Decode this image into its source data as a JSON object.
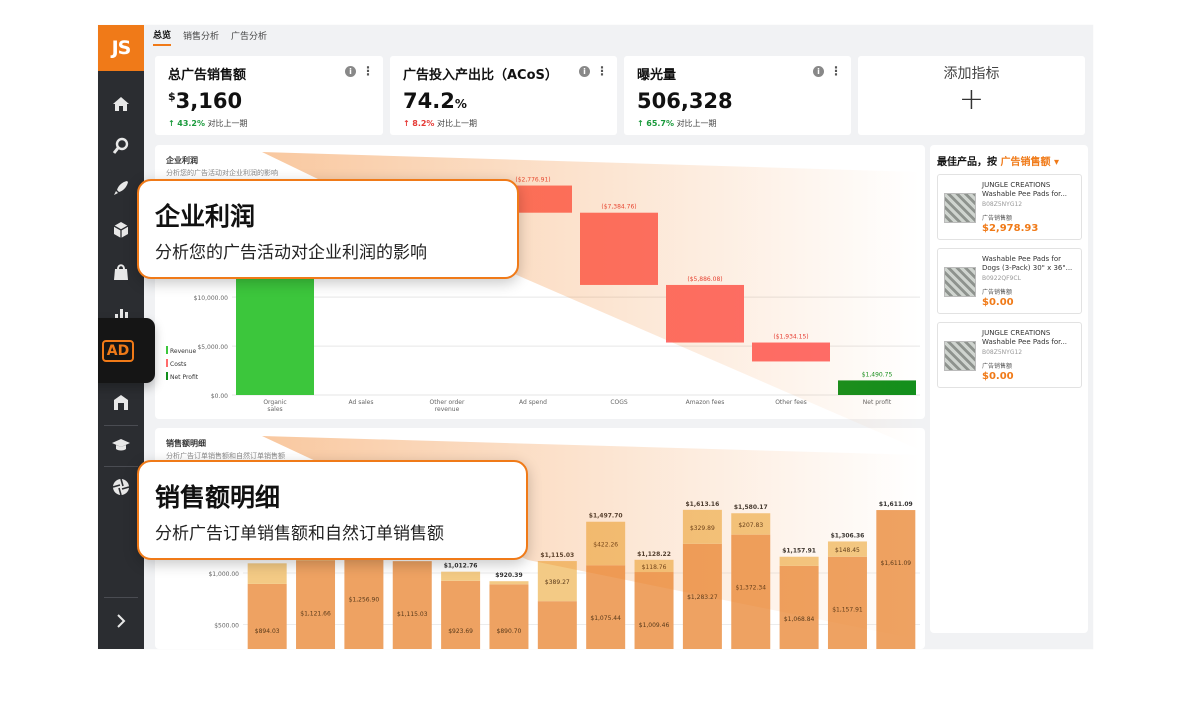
{
  "logo": "JS",
  "ad_badge": "AD",
  "tabs": [
    "总览",
    "销售分析",
    "广告分析"
  ],
  "kpis": [
    {
      "title": "总广告销售额",
      "currency": "$",
      "value": "3,160",
      "unit": "",
      "delta": "43.2%",
      "delta_color": "green",
      "compare": "对比上一期"
    },
    {
      "title": "广告投入产出比（ACoS）",
      "currency": "",
      "value": "74.2",
      "unit": "%",
      "delta": "8.2%",
      "delta_color": "red",
      "compare": "对比上一期"
    },
    {
      "title": "曝光量",
      "currency": "",
      "value": "506,328",
      "unit": "",
      "delta": "65.7%",
      "delta_color": "green",
      "compare": "对比上一期"
    }
  ],
  "add_kpi_label": "添加指标",
  "profit_panel": {
    "title": "企业利润",
    "subtitle": "分析您的广告活动对企业利润的影响",
    "legend": [
      "Revenue",
      "Costs",
      "Net Profit"
    ],
    "callout_title": "企业利润",
    "callout_sub": "分析您的广告活动对企业利润的影响"
  },
  "sales_panel": {
    "title": "销售额明细",
    "subtitle": "分析广告订单销售额和自然订单销售额",
    "callout_title": "销售额明细",
    "callout_sub": "分析广告订单销售额和自然订单销售额"
  },
  "right_panel": {
    "title": "最佳产品，按",
    "sort_by": "广告销售额",
    "products": [
      {
        "name": "JUNGLE CREATIONS Washable Pee Pads for...",
        "asin": "B08Z5NYG12",
        "label": "广告销售额",
        "value": "$2,978.93"
      },
      {
        "name": "Washable Pee Pads for Dogs (3-Pack) 30\" x 36\"...",
        "asin": "B0922QF9CL",
        "label": "广告销售额",
        "value": "$0.00"
      },
      {
        "name": "JUNGLE CREATIONS Washable Pee Pads for...",
        "asin": "B08Z5NYG12",
        "label": "广告销售额",
        "value": "$0.00"
      }
    ]
  },
  "colors": {
    "accent": "#f07a18",
    "revenue": "#3cc63c",
    "cost": "#ff6b6b",
    "net": "#128f1c",
    "organic_bar": "#eea262",
    "ad_bar": "#f3ca85"
  },
  "chart_data": [
    {
      "type": "bar",
      "subtype": "waterfall",
      "title": "企业利润",
      "categories": [
        "Organic sales",
        "Ad sales",
        "Other order revenue",
        "Ad spend",
        "COGS",
        "Amazon fees",
        "Other fees",
        "Net profit"
      ],
      "category_labels": [
        [
          "Organic",
          "sales"
        ],
        [
          "Ad sales"
        ],
        [
          "Other order",
          "revenue"
        ],
        [
          "Ad spend"
        ],
        [
          "COGS"
        ],
        [
          "Amazon fees"
        ],
        [
          "Other fees"
        ],
        [
          "Net profit"
        ]
      ],
      "values": [
        21411.12,
        0,
        0,
        -2776.91,
        -7384.76,
        -5886.08,
        -1934.15,
        1490.75
      ],
      "value_labels": [
        "",
        "",
        "",
        "($2,776.91)",
        "($7,384.76)",
        "($5,886.08)",
        "($1,934.15)",
        "$1,490.75"
      ],
      "kinds": [
        "revenue",
        "revenue",
        "revenue",
        "cost",
        "cost",
        "cost",
        "cost",
        "net"
      ],
      "y_ticks": [
        "$0.00",
        "$5,000.00",
        "$10,000.00"
      ],
      "ylim": [
        0,
        23000
      ]
    },
    {
      "type": "bar",
      "subtype": "stacked",
      "title": "销售额明细",
      "series": [
        {
          "name": "organic",
          "values": [
            894.03,
            1121.66,
            1256.9,
            1115.03,
            923.69,
            890.7,
            726.6,
            1075.44,
            1009.46,
            1283.27,
            1372.34,
            1068.84,
            1157.91,
            1611.09
          ]
        },
        {
          "name": "ad",
          "values": [
            200,
            150,
            100,
            0,
            89.07,
            29.69,
            389.27,
            422.26,
            118.76,
            329.89,
            207.83,
            89.07,
            148.45,
            0
          ]
        }
      ],
      "value_labels": {
        "organic": [
          "$894.03",
          "$1,121.66",
          "$1,256.90",
          "$1,115.03",
          "$923.69",
          "$890.70",
          "",
          "$1,075.44",
          "$1,009.46",
          "$1,283.27",
          "$1,372.34",
          "$1,068.84",
          "$1,157.91",
          "$1,611.09"
        ],
        "ad": [
          "",
          "",
          "",
          "",
          "",
          "",
          "$389.27",
          "$422.26",
          "$118.76",
          "$329.89",
          "$207.83",
          "",
          "$148.45",
          ""
        ],
        "total": [
          "",
          "",
          "",
          "",
          "$1,012.76",
          "$920.39",
          "$1,115.03",
          "$1,497.70",
          "$1,128.22",
          "$1,613.16",
          "$1,580.17",
          "$1,157.91",
          "$1,306.36",
          "$1,611.09"
        ]
      },
      "y_ticks": [
        "$500.00",
        "$1,000.00"
      ],
      "ylim": [
        0,
        2000
      ]
    }
  ]
}
